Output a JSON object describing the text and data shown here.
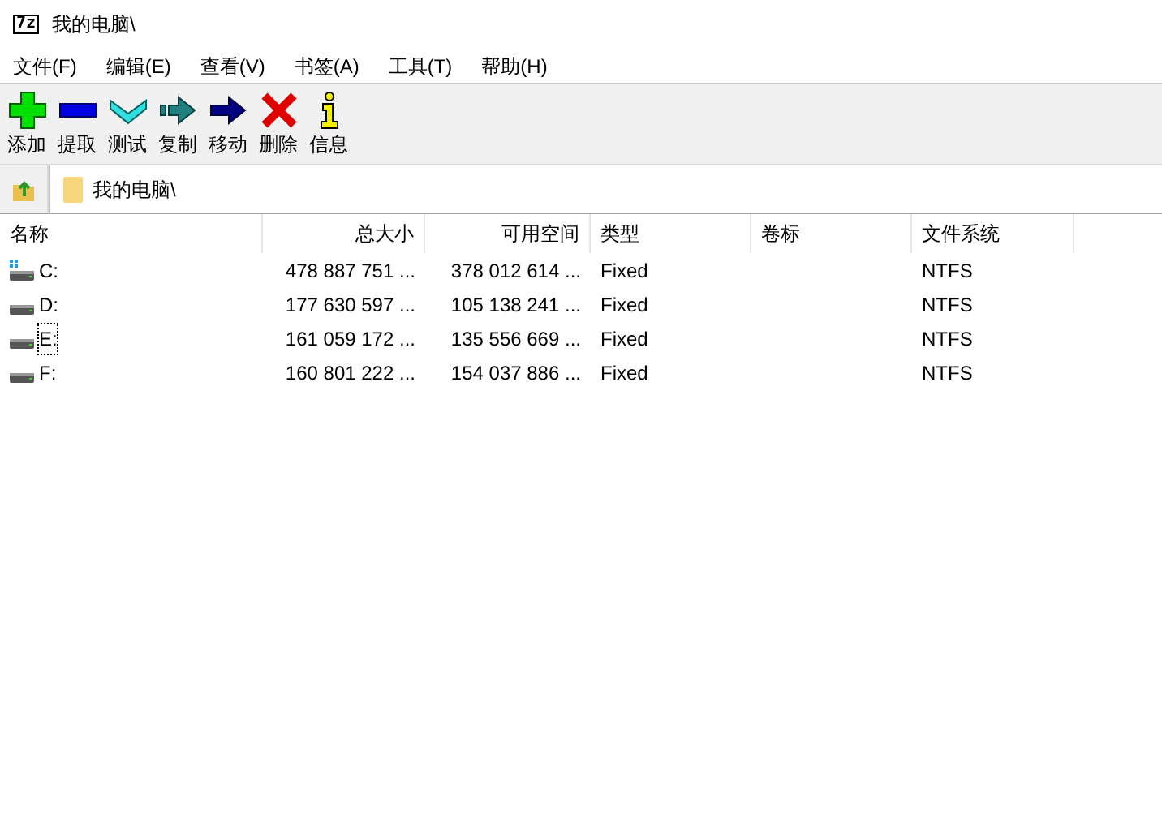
{
  "window": {
    "icon_text": "7z",
    "title": "我的电脑\\"
  },
  "menu": [
    "文件(F)",
    "编辑(E)",
    "查看(V)",
    "书签(A)",
    "工具(T)",
    "帮助(H)"
  ],
  "toolbar": [
    {
      "kind": "add",
      "label": "添加"
    },
    {
      "kind": "extract",
      "label": "提取"
    },
    {
      "kind": "test",
      "label": "测试"
    },
    {
      "kind": "copy",
      "label": "复制"
    },
    {
      "kind": "move",
      "label": "移动"
    },
    {
      "kind": "delete",
      "label": "删除"
    },
    {
      "kind": "info",
      "label": "信息"
    }
  ],
  "address": {
    "value": "我的电脑\\"
  },
  "table": {
    "columns": [
      {
        "label": "名称"
      },
      {
        "label": "总大小"
      },
      {
        "label": "可用空间"
      },
      {
        "label": "类型"
      },
      {
        "label": "卷标"
      },
      {
        "label": "文件系统"
      }
    ],
    "rows": [
      {
        "kind": "system",
        "focused": false,
        "cells": [
          "C:",
          "478 887 751 ...",
          "378 012 614 ...",
          "Fixed",
          "",
          "NTFS"
        ]
      },
      {
        "kind": "drive",
        "focused": false,
        "cells": [
          "D:",
          "177 630 597 ...",
          "105 138 241 ...",
          "Fixed",
          "",
          "NTFS"
        ]
      },
      {
        "kind": "drive",
        "focused": true,
        "cells": [
          "E:",
          "161 059 172 ...",
          "135 556 669 ...",
          "Fixed",
          "",
          "NTFS"
        ]
      },
      {
        "kind": "drive",
        "focused": false,
        "cells": [
          "F:",
          "160 801 222 ...",
          "154 037 886 ...",
          "Fixed",
          "",
          "NTFS"
        ]
      }
    ]
  }
}
